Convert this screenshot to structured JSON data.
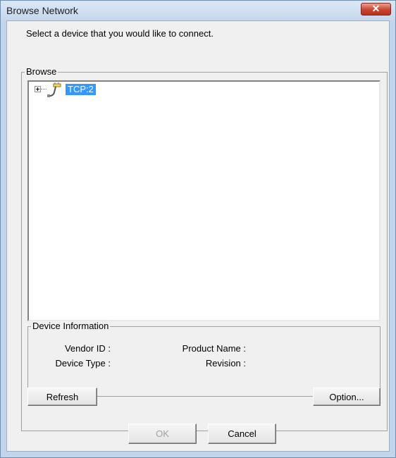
{
  "window": {
    "title": "Browse Network",
    "close_icon": "close-icon"
  },
  "instruction": "Select a device that you would like to connect.",
  "browse_group": {
    "legend": "Browse",
    "tree": [
      {
        "label": "TCP:2",
        "icon": "network-plug-icon",
        "expanded": false,
        "selected": true
      }
    ]
  },
  "device_info": {
    "legend": "Device Information",
    "vendor_id_label": "Vendor ID :",
    "product_name_label": "Product Name :",
    "device_type_label": "Device Type :",
    "revision_label": "Revision :"
  },
  "buttons": {
    "refresh": "Refresh",
    "option": "Option...",
    "ok": "OK",
    "cancel": "Cancel"
  },
  "colors": {
    "selection": "#3399ff",
    "titlebar": "#c6d8ed",
    "close": "#c8452f",
    "dialog_bg": "#f0f0f0"
  }
}
